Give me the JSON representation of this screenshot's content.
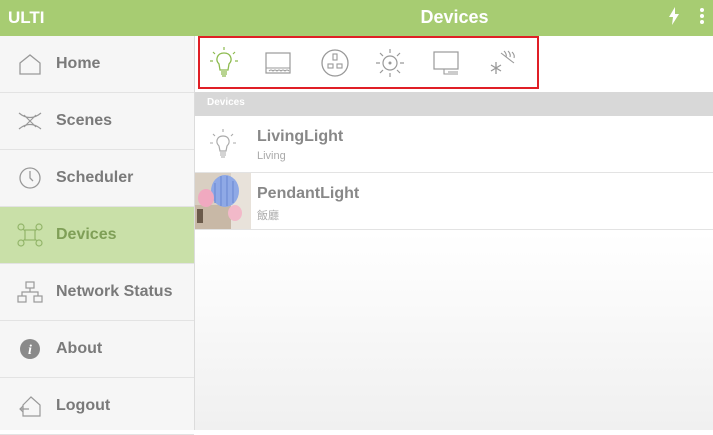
{
  "app": {
    "brand": "ULTI",
    "title": "Devices"
  },
  "top_icons": [
    "flash-icon",
    "more-vert-icon"
  ],
  "sidebar": {
    "items": [
      {
        "label": "Home",
        "icon": "home-icon",
        "active": false
      },
      {
        "label": "Scenes",
        "icon": "scenes-icon",
        "active": false
      },
      {
        "label": "Scheduler",
        "icon": "clock-icon",
        "active": false
      },
      {
        "label": "Devices",
        "icon": "devices-icon",
        "active": true
      },
      {
        "label": "Network Status",
        "icon": "network-icon",
        "active": false
      },
      {
        "label": "About",
        "icon": "info-icon",
        "active": false
      },
      {
        "label": "Logout",
        "icon": "logout-icon",
        "active": false
      }
    ]
  },
  "toolbar": {
    "tools": [
      "lightbulb-icon",
      "curtain-icon",
      "socket-icon",
      "sun-icon",
      "screen-icon",
      "aircon-icon"
    ]
  },
  "devices_section": {
    "header": "Devices"
  },
  "devices": [
    {
      "name": "LivingLight",
      "room": "Living",
      "icon": "lightbulb-icon"
    },
    {
      "name": "PendantLight",
      "room": "飯廳",
      "icon": "pendant-light-thumbnail"
    }
  ],
  "colors": {
    "accent": "#a7cc72",
    "active_bg": "#c9e0a8",
    "highlight": "#e01f26"
  }
}
